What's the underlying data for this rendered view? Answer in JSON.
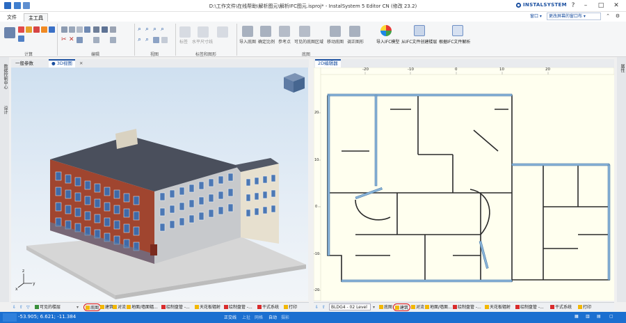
{
  "window": {
    "title": "D:\\工作文件\\在线帮助\\解析图元\\解析IFC图元.isproj* - InstalSystem 5 Editor CN (修改 23.2)",
    "brand": "INSTALSYSTEM"
  },
  "menu": {
    "file": "文件",
    "main_tools": "主工具",
    "window": "窗口 ▾",
    "layout": "更改屏幕的窗口布 ▾"
  },
  "ribbon": {
    "groups": {
      "calc": "计算",
      "edit": "编辑",
      "view": "视图",
      "annot": "标签和图形",
      "base": "底图"
    },
    "annot_buttons": [
      "标签",
      "水平尺寸线"
    ],
    "base_buttons": [
      "导入底图",
      "确定比例",
      "参考点",
      "可见的底图区域",
      "移动底图",
      "调正图形"
    ],
    "ifc_buttons": [
      "导入IFC模型",
      "从IFC文件创建楼层",
      "根据IFC文件解析"
    ]
  },
  "left_tabs": {
    "general": "一般参数",
    "view3d": "● 3D视图"
  },
  "right_tabs": {
    "editor2d": "2D编辑器"
  },
  "side_labels": {
    "left1": "数据控制中心",
    "left2": "设计",
    "right1": "属性"
  },
  "ruler_h_ticks": [
    "-20",
    "-10",
    "0",
    "10",
    "20"
  ],
  "ruler_v_ticks": [
    "20",
    "10",
    "0",
    "-10",
    "-20"
  ],
  "layers_left": {
    "visible_floors": "可见的楼层",
    "items": [
      "底图",
      "建筑",
      "对流",
      "地面/墙面辐...",
      "绘制盘管 -...",
      "天花板辐射",
      "绘制盘管 -...",
      "干式系统",
      "打印"
    ]
  },
  "layers_right": {
    "level": "BLDG4 - 02 Level",
    "items": [
      "底图",
      "建筑",
      "对流",
      "地面/墙面...",
      "绘制盘管 -...",
      "天花板辐射",
      "绘制盘管 -...",
      "干式系统",
      "打印"
    ]
  },
  "status": {
    "coords": "-53.905; 6.621; -11.384",
    "ortho": "正交线",
    "snap1": "上扯",
    "snap2": "网格",
    "auto": "自动",
    "other": "摄影"
  },
  "colors": {
    "accent": "#1b6fd0",
    "highlight_circle": "#d11111",
    "wall_fill": "#8ab4d8"
  }
}
